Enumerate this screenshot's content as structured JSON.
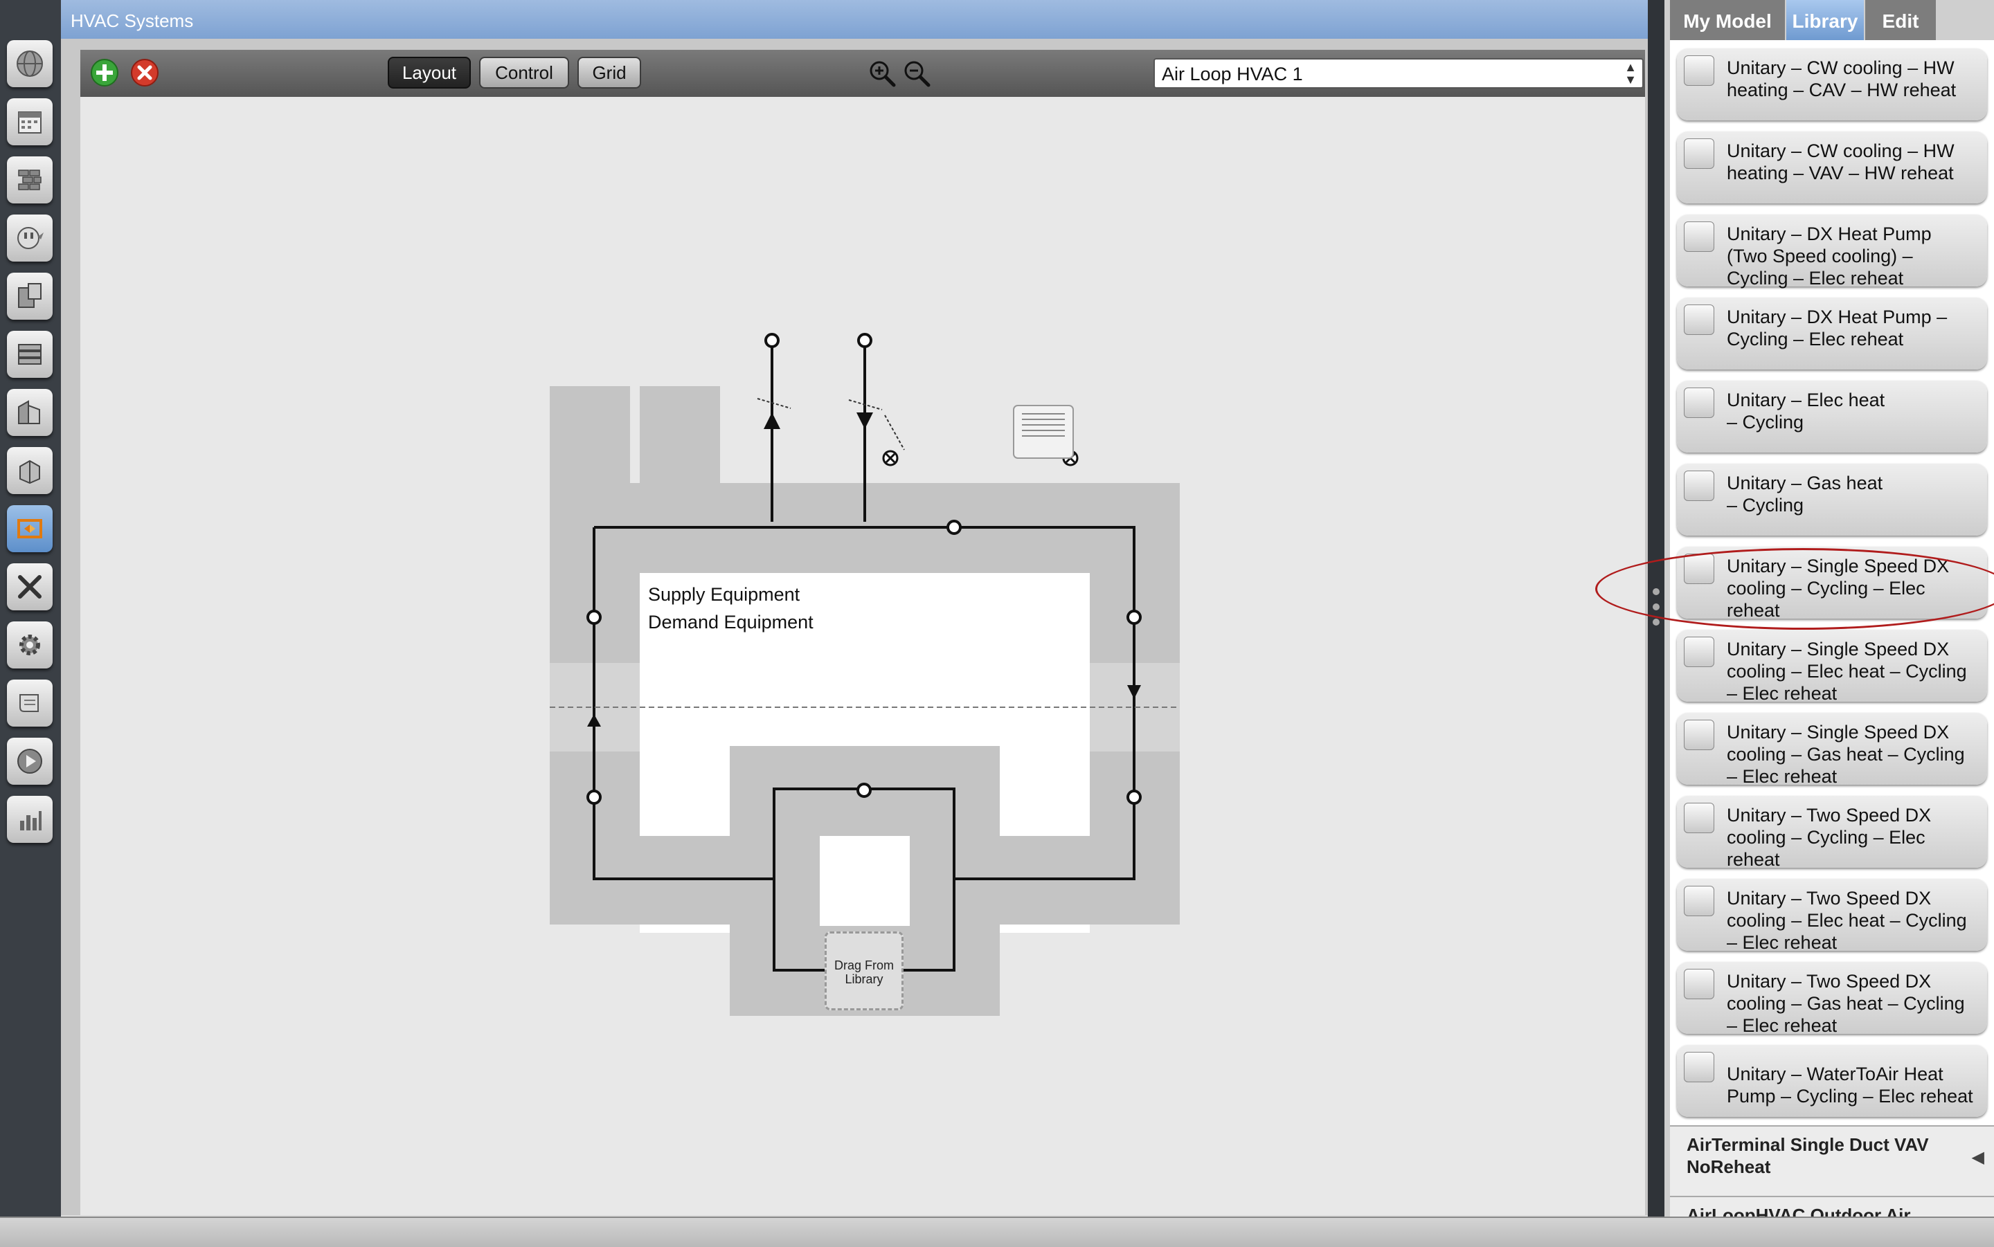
{
  "window": {
    "title": "HVAC Systems"
  },
  "toolbar": {
    "layout_label": "Layout",
    "control_label": "Control",
    "grid_label": "Grid",
    "active_view": "Layout",
    "air_loop_selected": "Air Loop HVAC 1"
  },
  "diagram": {
    "supply_label": "Supply Equipment",
    "demand_label": "Demand Equipment",
    "drop_zone_label": "Drag From\nLibrary"
  },
  "right_panel": {
    "tabs": [
      {
        "label": "My Model"
      },
      {
        "label": "Library"
      },
      {
        "label": "Edit"
      }
    ],
    "active_tab": "Library",
    "library_items": [
      {
        "label": "Unitary – CW cooling – HW\nheating – CAV – HW reheat"
      },
      {
        "label": "Unitary – CW cooling – HW\nheating – VAV – HW reheat"
      },
      {
        "label": "Unitary – DX Heat Pump\n(Two Speed cooling) –\nCycling – Elec reheat"
      },
      {
        "label": "Unitary – DX Heat Pump –\nCycling – Elec reheat"
      },
      {
        "label": "Unitary – Elec heat\n– Cycling"
      },
      {
        "label": "Unitary – Gas heat\n– Cycling"
      },
      {
        "label": "Unitary – Single Speed DX\ncooling – Cycling – Elec\nreheat"
      },
      {
        "label": "Unitary – Single Speed DX\ncooling – Elec heat – Cycling\n– Elec reheat"
      },
      {
        "label": "Unitary – Single Speed DX\ncooling – Gas heat – Cycling\n– Elec reheat"
      },
      {
        "label": "Unitary – Two Speed DX\ncooling – Cycling – Elec\nreheat"
      },
      {
        "label": "Unitary – Two Speed DX\ncooling – Elec heat – Cycling\n– Elec reheat"
      },
      {
        "label": "Unitary – Two Speed DX\ncooling – Gas heat – Cycling\n– Elec reheat"
      },
      {
        "label": "Unitary – WaterToAir Heat\nPump – Cycling – Elec reheat"
      }
    ],
    "sections": [
      {
        "label": "AirTerminal Single Duct VAV\nNoReheat"
      },
      {
        "label": "AirLoopHVAC Outdoor Air"
      }
    ]
  },
  "icons": {
    "left_toolbar": [
      "globe-icon",
      "calendar-icon",
      "constructions-icon",
      "loads-icon",
      "space-types-icon",
      "geometry-icon",
      "facility-icon",
      "spaces-icon",
      "hvac-icon",
      "measures-icon",
      "settings-icon",
      "scripts-icon",
      "run-icon",
      "results-icon"
    ],
    "active_tool": "hvac-icon"
  },
  "colors": {
    "accent_blue": "#7ea2d2",
    "add_green": "#3aa53a",
    "remove_red": "#d33b2b",
    "highlight_red": "#b01c1c"
  }
}
